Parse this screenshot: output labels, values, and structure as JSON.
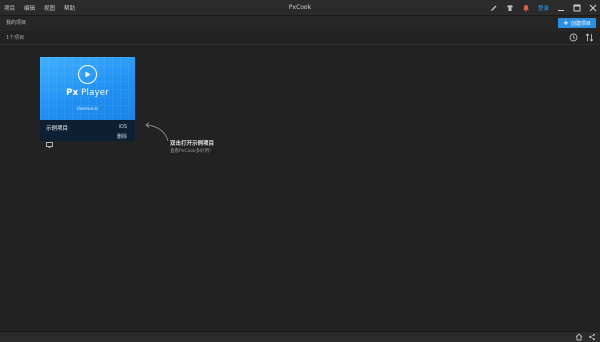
{
  "titlebar": {
    "menu": [
      "项目",
      "编辑",
      "视图",
      "帮助"
    ],
    "app_title": "PxCook",
    "login_label": "登录"
  },
  "header": {
    "my_projects": "我的项目",
    "new_project_label": "创建项目"
  },
  "subheader": {
    "count": "1个项目"
  },
  "card": {
    "thumb_title_bold": "Px",
    "thumb_title": " Player",
    "thumb_subtitle": "Usemonic",
    "name": "示例项目",
    "platform": "iOS",
    "delete_label": "删除"
  },
  "hint": {
    "title": "双击打开示例项目",
    "subtitle": "查看PxCook多好用!"
  },
  "colors": {
    "accent": "#2d8fe0",
    "card_blue": "#1f8ff2",
    "background": "#222222"
  }
}
